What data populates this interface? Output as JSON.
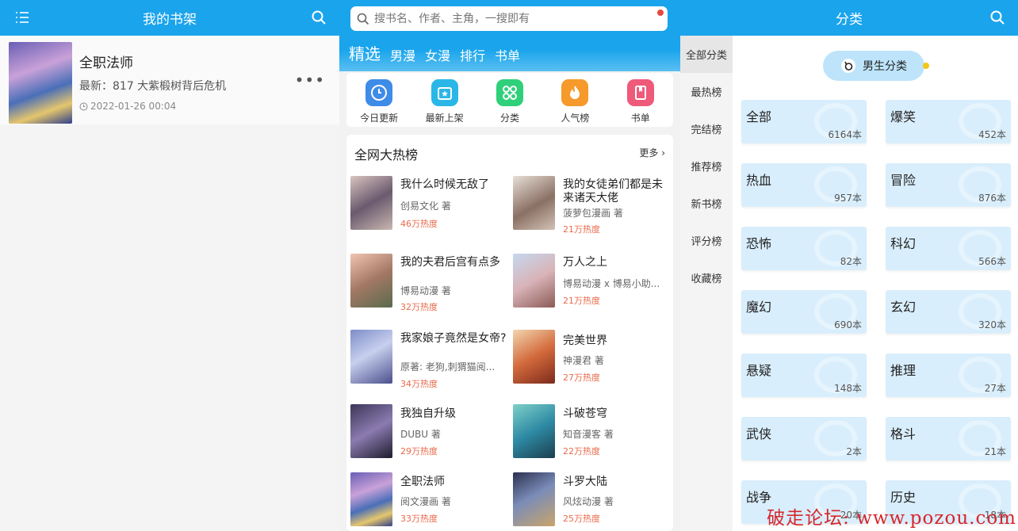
{
  "bookshelf": {
    "title": "我的书架",
    "menu_icon": "list-menu-icon",
    "search_icon": "search-icon",
    "items": [
      {
        "title": "全职法师",
        "latest": "最新：817 大紫椴树背后危机",
        "date": "2022-01-26 00:04"
      }
    ]
  },
  "featured": {
    "search_placeholder": "搜书名、作者、主角，一搜即有",
    "tabs": [
      "精选",
      "男漫",
      "女漫",
      "排行",
      "书单"
    ],
    "quick": [
      {
        "label": "今日更新",
        "icon": "clock-icon",
        "color": "#3f8be8"
      },
      {
        "label": "最新上架",
        "icon": "star-box-icon",
        "color": "#2ab7e8"
      },
      {
        "label": "分类",
        "icon": "grid-icon",
        "color": "#2fd07a"
      },
      {
        "label": "人气榜",
        "icon": "flame-icon",
        "color": "#f59a2b"
      },
      {
        "label": "书单",
        "icon": "book-icon",
        "color": "#ef5a7a"
      }
    ],
    "hot_title": "全网大热榜",
    "hot_more": "更多",
    "hot_list": [
      {
        "title": "我什么时候无敌了",
        "author": "创易文化 著",
        "heat": "46万热度"
      },
      {
        "title": "我的女徒弟们都是未来诸天大佬",
        "author": "菠萝包漫画 著",
        "heat": "21万热度"
      },
      {
        "title": "我的夫君后宫有点多",
        "author": "博易动漫 著",
        "heat": "32万热度"
      },
      {
        "title": "万人之上",
        "author": "博易动漫 x 博易小助...",
        "heat": "21万热度"
      },
      {
        "title": "我家娘子竟然是女帝?",
        "author": "原著: 老狗,刺猬猫阅...",
        "heat": "34万热度"
      },
      {
        "title": "完美世界",
        "author": "神漫君 著",
        "heat": "27万热度"
      },
      {
        "title": "我独自升级",
        "author": "DUBU 著",
        "heat": "29万热度"
      },
      {
        "title": "斗破苍穹",
        "author": "知音漫客 著",
        "heat": "22万热度"
      },
      {
        "title": "全职法师",
        "author": "阅文漫画 著",
        "heat": "33万热度"
      },
      {
        "title": "斗罗大陆",
        "author": "风炫动漫 著",
        "heat": "25万热度"
      }
    ]
  },
  "category": {
    "title": "分类",
    "search_icon": "search-icon",
    "side": [
      "全部分类",
      "最热榜",
      "完结榜",
      "推荐榜",
      "新书榜",
      "评分榜",
      "收藏榜"
    ],
    "side_active": "全部分类",
    "pill": "男生分类",
    "cards": [
      {
        "name": "全部",
        "count": "6164本"
      },
      {
        "name": "爆笑",
        "count": "452本"
      },
      {
        "name": "热血",
        "count": "957本"
      },
      {
        "name": "冒险",
        "count": "876本"
      },
      {
        "name": "恐怖",
        "count": "82本"
      },
      {
        "name": "科幻",
        "count": "566本"
      },
      {
        "name": "魔幻",
        "count": "690本"
      },
      {
        "name": "玄幻",
        "count": "320本"
      },
      {
        "name": "悬疑",
        "count": "148本"
      },
      {
        "name": "推理",
        "count": "27本"
      },
      {
        "name": "武侠",
        "count": "2本"
      },
      {
        "name": "格斗",
        "count": "21本"
      },
      {
        "name": "战争",
        "count": "20本"
      },
      {
        "name": "历史",
        "count": "18本"
      }
    ]
  },
  "watermark": "破走论坛: www.pozou.com"
}
